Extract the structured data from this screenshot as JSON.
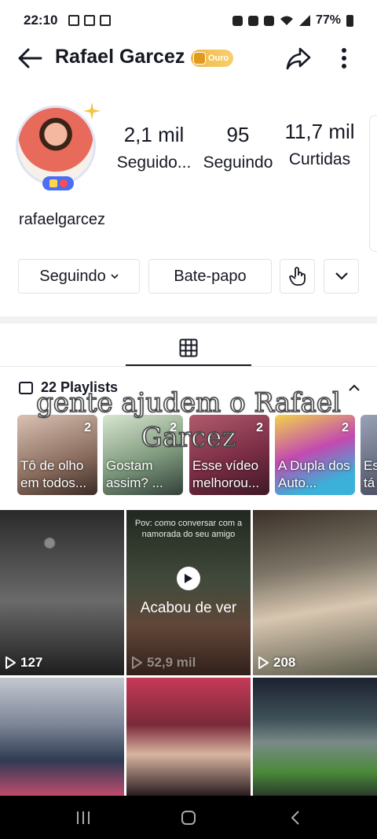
{
  "status_bar": {
    "time": "22:10",
    "battery": "77%"
  },
  "header": {
    "name": "Rafael Garcez",
    "badge": "Ouro"
  },
  "stats": {
    "followers": {
      "value": "2,1 mil",
      "label": "Seguido..."
    },
    "following": {
      "value": "95",
      "label": "Seguindo"
    },
    "likes": {
      "value": "11,7 mil",
      "label": "Curtidas"
    }
  },
  "username": "rafaelgarcez",
  "actions": {
    "following_label": "Seguindo",
    "chat_label": "Bate-papo"
  },
  "playlists": {
    "title": "22 Playlists",
    "items": [
      {
        "title": "Tô de olho em todos...",
        "count": "2"
      },
      {
        "title": "Gostam assim? ...",
        "count": "2"
      },
      {
        "title": "Esse vídeo melhorou...",
        "count": "2"
      },
      {
        "title": "A Dupla dos Auto...",
        "count": "2"
      },
      {
        "title": "Es tá",
        "count": ""
      }
    ]
  },
  "overlay_caption": {
    "line1": "gente ajudem o Rafael",
    "line2": "Garcez"
  },
  "videos": [
    {
      "views": "127"
    },
    {
      "views": "52,9 mil",
      "status": "Acabou de ver",
      "top_text": "Pov: como conversar com a namorada do seu amigo"
    },
    {
      "views": "208"
    },
    {
      "views": ""
    },
    {
      "views": ""
    },
    {
      "views": ""
    }
  ],
  "icons": {
    "back": "arrow-left-icon",
    "share": "share-arrow-icon",
    "more": "more-vertical-icon",
    "grid": "grid-icon",
    "playlist": "playlist-icon",
    "play": "play-icon"
  },
  "colors": {
    "text": "#161823",
    "border": "#e3e3e4",
    "badge_gold": "#f0b84a",
    "nav_bg": "#000000"
  }
}
